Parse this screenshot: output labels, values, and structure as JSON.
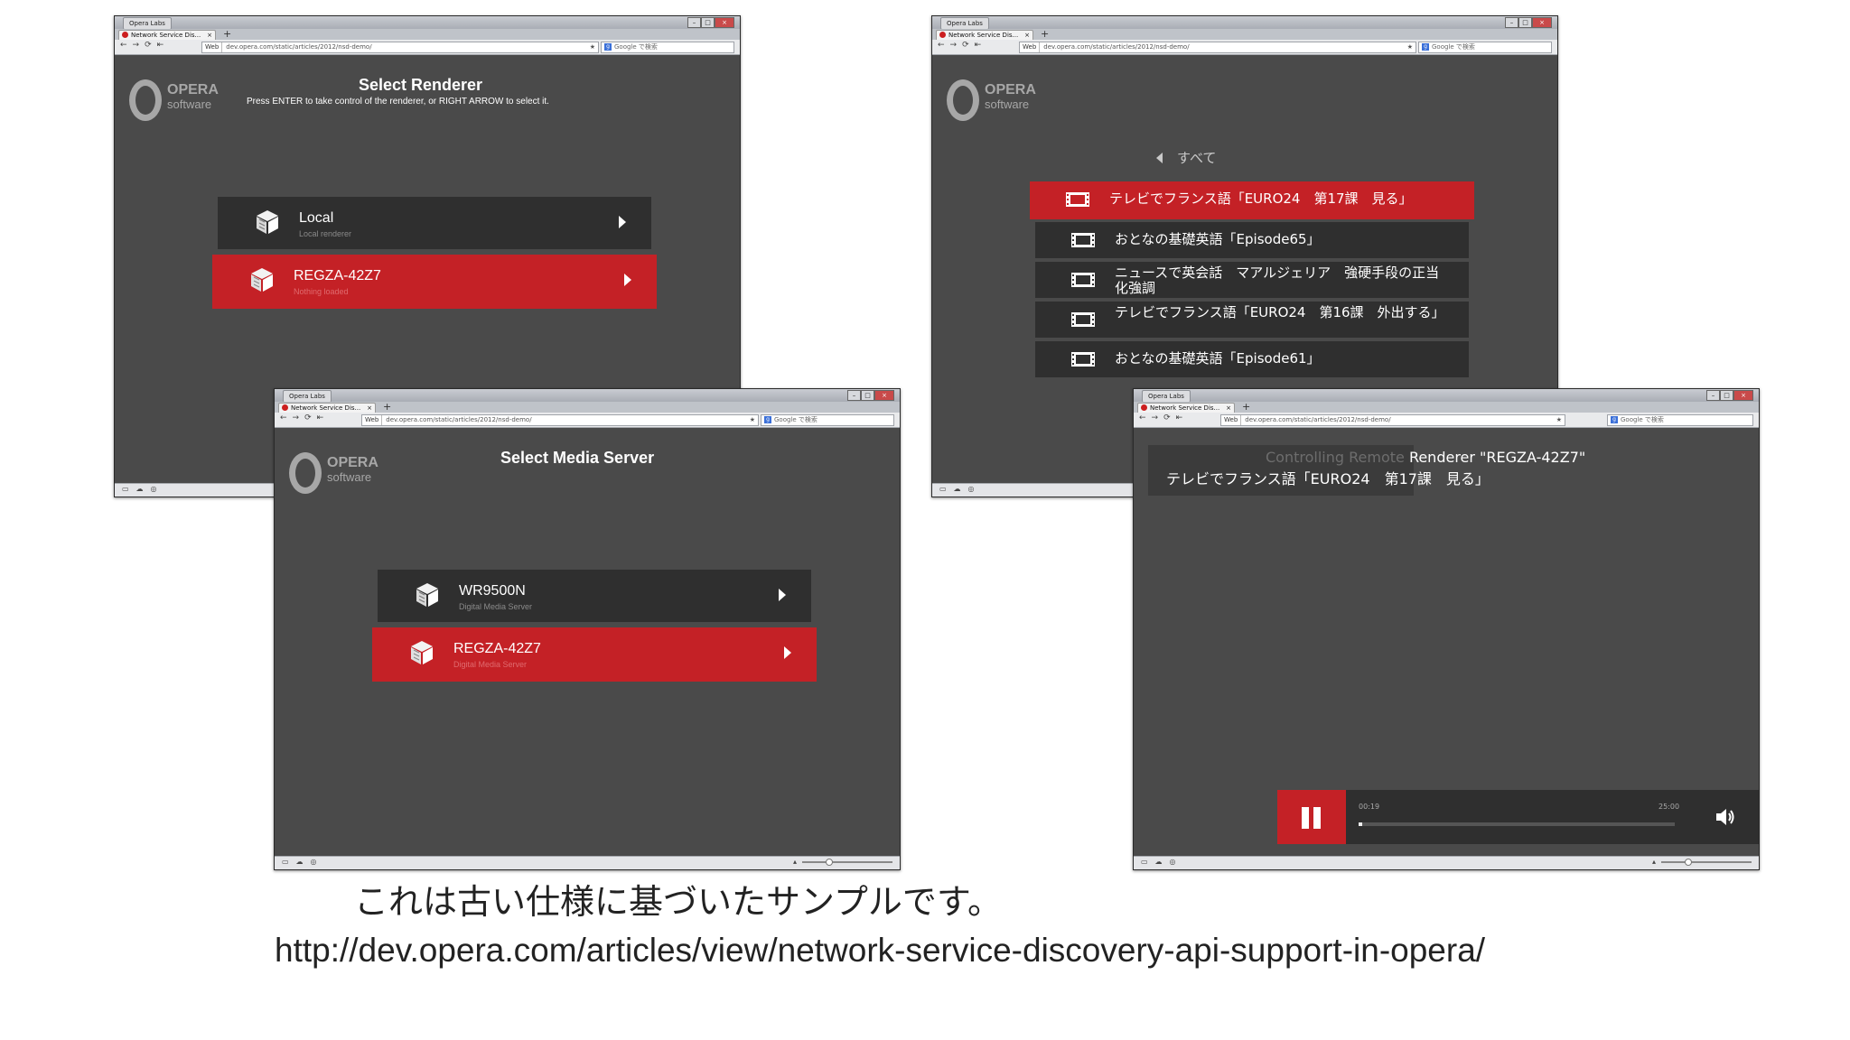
{
  "browser": {
    "opera_labs": "Opera Labs",
    "tab_label": "Network Service Dis...",
    "tab_close": "×",
    "new_tab": "+",
    "web_label": "Web",
    "url_short": "dev.opera.com/static/articles/2012/nsd-demo/",
    "url_variant": "dev.opera.com/static/articles/2012/nsd-demo/",
    "search_placeholder": "Google で検索"
  },
  "logo": {
    "line1": "OPERA",
    "line2": "software"
  },
  "window1": {
    "title": "Select Renderer",
    "subtitle": "Press ENTER to take control of the renderer, or RIGHT ARROW to select it.",
    "items": [
      {
        "label": "Local",
        "sub": "Local renderer"
      },
      {
        "label": "REGZA-42Z7",
        "sub": "Nothing loaded"
      }
    ]
  },
  "window2": {
    "back_label": "すべて",
    "items": [
      {
        "label": "テレビでフランス語「EURO24　第17課　見る」"
      },
      {
        "label": "おとなの基礎英語「Episode65」"
      },
      {
        "label": "ニュースで英会話　マアルジェリア　強硬手段の正当化強調"
      },
      {
        "label": "テレビでフランス語「EURO24　第16課　外出する」"
      },
      {
        "label": "おとなの基礎英語「Episode61」"
      }
    ]
  },
  "window3": {
    "title": "Select Media Server",
    "items": [
      {
        "label": "WR9500N",
        "sub": "Digital Media Server"
      },
      {
        "label": "REGZA-42Z7",
        "sub": "Digital Media Server"
      }
    ]
  },
  "window4": {
    "controlling_ghost": "Controlling Remote",
    "controlling_rest": "Renderer \"REGZA-42Z7\"",
    "now_playing": "テレビでフランス語「EURO24　第17課　見る」",
    "time_current": "00:19",
    "time_total": "25:00",
    "progress": 0.01
  },
  "caption": {
    "line1": "これは古い仕様に基づいたサンプルです。",
    "line2": "http://dev.opera.com/articles/view/network-service-discovery-api-support-in-opera/"
  }
}
